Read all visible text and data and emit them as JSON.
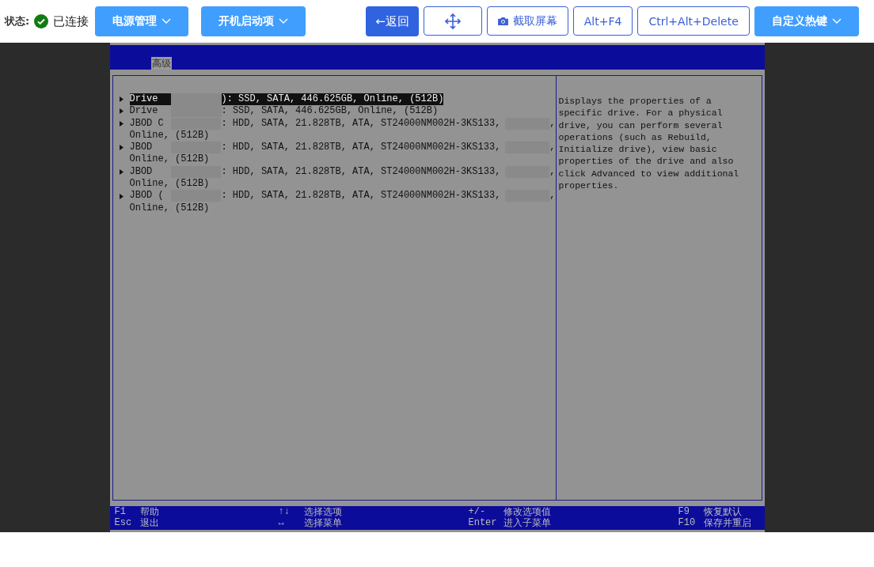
{
  "status": {
    "label": "状态:",
    "value": "已连接"
  },
  "toolbar": [
    {
      "kind": "dropdown",
      "label": "电源管理"
    },
    {
      "kind": "dropdown",
      "label": "开机启动项"
    },
    {
      "kind": "primary",
      "label": "←返回"
    },
    {
      "kind": "move"
    },
    {
      "kind": "screenshot",
      "label": "截取屏幕"
    },
    {
      "kind": "outline",
      "label": "Alt+F4"
    },
    {
      "kind": "outline",
      "label": "Ctrl+Alt+Delete"
    },
    {
      "kind": "dropdown",
      "label": "自定义热键"
    }
  ],
  "console": {
    "tab": "高级",
    "items": [
      {
        "prefix": "Drive",
        "suffix": "): SSD, SATA, 446.625GB, Online, (512B)",
        "selected": true
      },
      {
        "prefix": "Drive",
        "suffix": ": SSD, SATA, 446.625GB, Online, (512B)",
        "selected": false
      },
      {
        "prefix": "JBOD C",
        "suffix": ": HDD, SATA, 21.828TB, ATA, ST24000NM002H-3KS133,",
        "tail": ",",
        "line2": "Online, (512B)",
        "selected": false
      },
      {
        "prefix": "JBOD",
        "suffix": ": HDD, SATA, 21.828TB, ATA, ST24000NM002H-3KS133,",
        "tail": ",",
        "line2": "Online, (512B)",
        "selected": false
      },
      {
        "prefix": "JBOD",
        "suffix": ": HDD, SATA, 21.828TB, ATA, ST24000NM002H-3KS133,",
        "tail": ",",
        "line2": "Online, (512B)",
        "selected": false
      },
      {
        "prefix": "JBOD (",
        "suffix": ": HDD, SATA, 21.828TB, ATA, ST24000NM002H-3KS133,",
        "tail": ",",
        "line2": "Online, (512B)",
        "selected": false
      }
    ],
    "help": "Displays the properties of a specific drive. For a physical drive, you can perform several operations (such as Rebuild, Initialize drive), view basic properties of the drive and also click Advanced to view additional properties.",
    "footer": [
      [
        {
          "key": "F1",
          "label": "帮助"
        },
        {
          "key": "Esc",
          "label": "退出"
        }
      ],
      [
        {
          "key": "↑↓",
          "label": "选择选项"
        },
        {
          "key": "↔",
          "label": "选择菜单"
        }
      ],
      [
        {
          "key": "+/-",
          "label": "修改选项值"
        },
        {
          "key": "Enter",
          "label": "进入子菜单"
        }
      ],
      [
        {
          "key": "F9",
          "label": "恢复默认"
        },
        {
          "key": "F10",
          "label": "保存并重启"
        }
      ]
    ]
  }
}
